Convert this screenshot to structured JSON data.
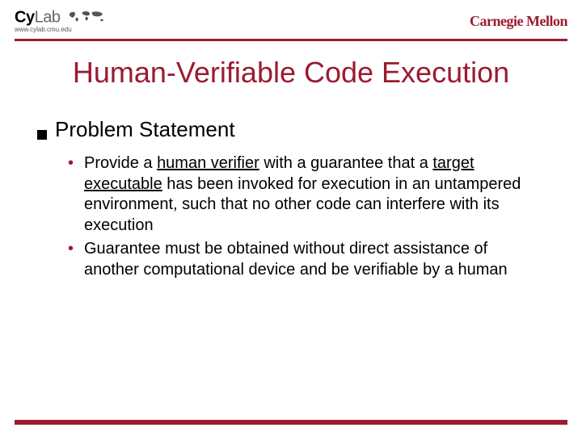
{
  "header": {
    "logo_left_cy": "Cy",
    "logo_left_lab": "Lab",
    "logo_left_url": "www.cylab.cmu.edu",
    "logo_right": "Carnegie Mellon"
  },
  "title": "Human-Verifiable Code Execution",
  "section": {
    "heading": "Problem Statement",
    "bullets": [
      {
        "pre": "Provide a ",
        "u1": "human verifier",
        "mid": " with a guarantee that a ",
        "u2": "target executable",
        "post": " has been invoked for execution in an untampered environment, such that no other code can interfere with its execution"
      },
      {
        "pre": "Guarantee must be obtained without direct assistance of another computational device and be verifiable by a human",
        "u1": "",
        "mid": "",
        "u2": "",
        "post": ""
      }
    ]
  }
}
